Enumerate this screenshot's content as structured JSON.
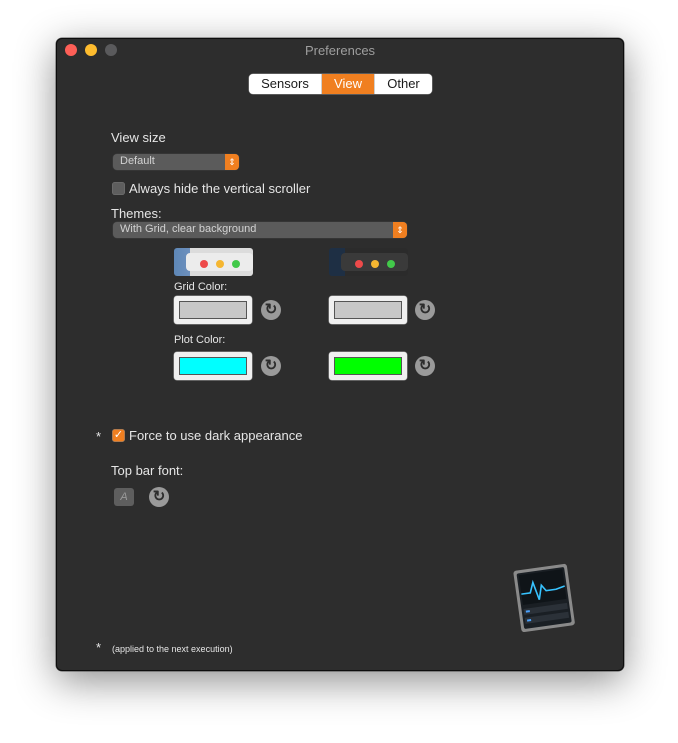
{
  "window": {
    "title": "Preferences"
  },
  "tabs": [
    {
      "label": "Sensors",
      "selected": false
    },
    {
      "label": "View",
      "selected": true
    },
    {
      "label": "Other",
      "selected": false
    }
  ],
  "view_size": {
    "label": "View size",
    "value": "Default"
  },
  "hide_scroller": {
    "label": "Always hide the vertical scroller",
    "checked": false
  },
  "themes": {
    "label": "Themes:",
    "value": "With Grid, clear background"
  },
  "grid_color": {
    "label": "Grid Color:",
    "light_theme_color": "#c8c8c8",
    "dark_theme_color": "#c8c8c8"
  },
  "plot_color": {
    "label": "Plot Color:",
    "light_theme_color": "#00ffff",
    "dark_theme_color": "#00ff00"
  },
  "dark_appearance": {
    "asterisk": "*",
    "label": "Force to use dark appearance",
    "checked": true
  },
  "top_bar_font": {
    "label": "Top bar font:",
    "button_glyph": "A"
  },
  "footer": {
    "asterisk": "*",
    "note": "(applied to the next execution)"
  },
  "icons": {
    "reset": "reset-icon",
    "popup_arrows": "up-down-arrows-icon",
    "app": "app-icon"
  },
  "colors": {
    "accent": "#f07f20",
    "window_bg": "#2d2d2d"
  }
}
